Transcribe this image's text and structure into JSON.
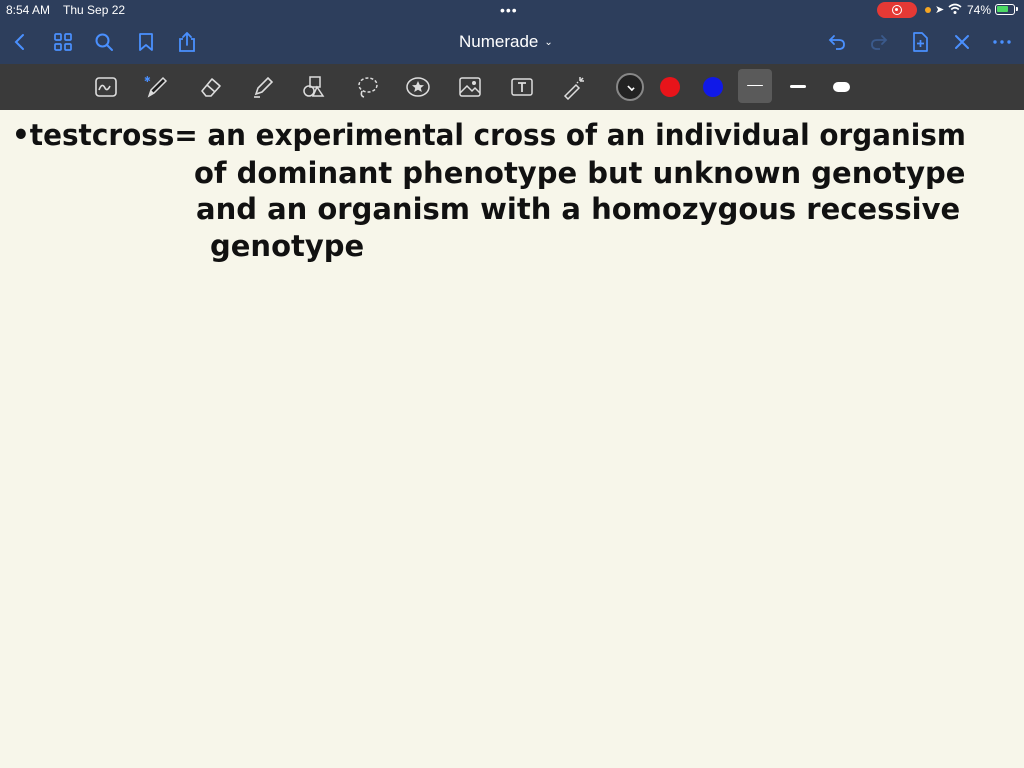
{
  "status_bar": {
    "time": "8:54 AM",
    "date": "Thu Sep 22",
    "battery_percent": "74%",
    "battery_level": 0.74,
    "recording_color": "#e53935"
  },
  "nav": {
    "title": "Numerade",
    "accent_color": "#4a90ff",
    "bar_color": "#2d3e5c",
    "icons": [
      "back-chevron-icon",
      "grid-icon",
      "search-icon",
      "bookmark-icon",
      "share-icon",
      "undo-icon",
      "redo-icon",
      "add-page-icon",
      "close-icon",
      "more-icon"
    ]
  },
  "toolbar": {
    "tools": [
      "scan-icon",
      "pen-icon",
      "eraser-icon",
      "highlighter-icon",
      "shapes-icon",
      "lasso-icon",
      "sticker-icon",
      "image-icon",
      "text-icon",
      "laser-icon"
    ],
    "colors": [
      "#222222",
      "#e8141a",
      "#1019e8"
    ],
    "selected_color": "#222222",
    "stroke_widths": [
      "thin",
      "medium",
      "thick"
    ],
    "selected_stroke": "thin"
  },
  "note": {
    "lines": [
      "•testcross= an experimental cross of an individual organism",
      "of dominant phenotype but unknown genotype",
      "and an organism with a homozygous recessive",
      "genotype"
    ]
  }
}
